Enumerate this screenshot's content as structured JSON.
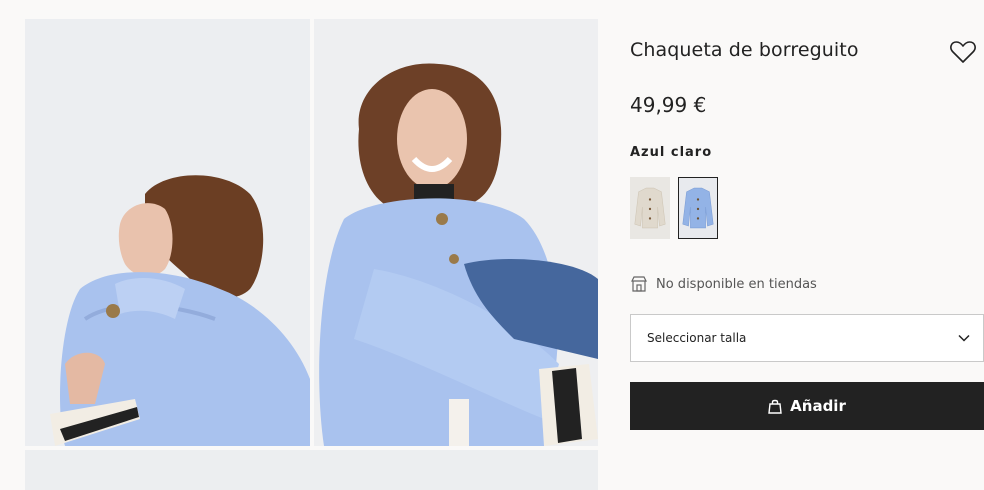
{
  "product": {
    "title": "Chaqueta de borreguito",
    "price": "49,99 €",
    "color_label": "Azul claro",
    "swatches": [
      {
        "name": "beige",
        "color": "#e2ddd3",
        "selected": false
      },
      {
        "name": "azul claro",
        "color": "#9bb8e6",
        "selected": true
      }
    ]
  },
  "availability": {
    "text": "No disponible en tiendas",
    "icon": "store-icon"
  },
  "size_select": {
    "label": "Seleccionar talla",
    "icon": "chevron-down-icon"
  },
  "add_button": {
    "label": "Añadir",
    "icon": "bag-icon"
  },
  "favorite": {
    "icon": "heart-icon"
  },
  "colors": {
    "button_bg": "#222222",
    "jacket_blue": "#a9c2ee",
    "page_bg": "#faf9f8"
  }
}
